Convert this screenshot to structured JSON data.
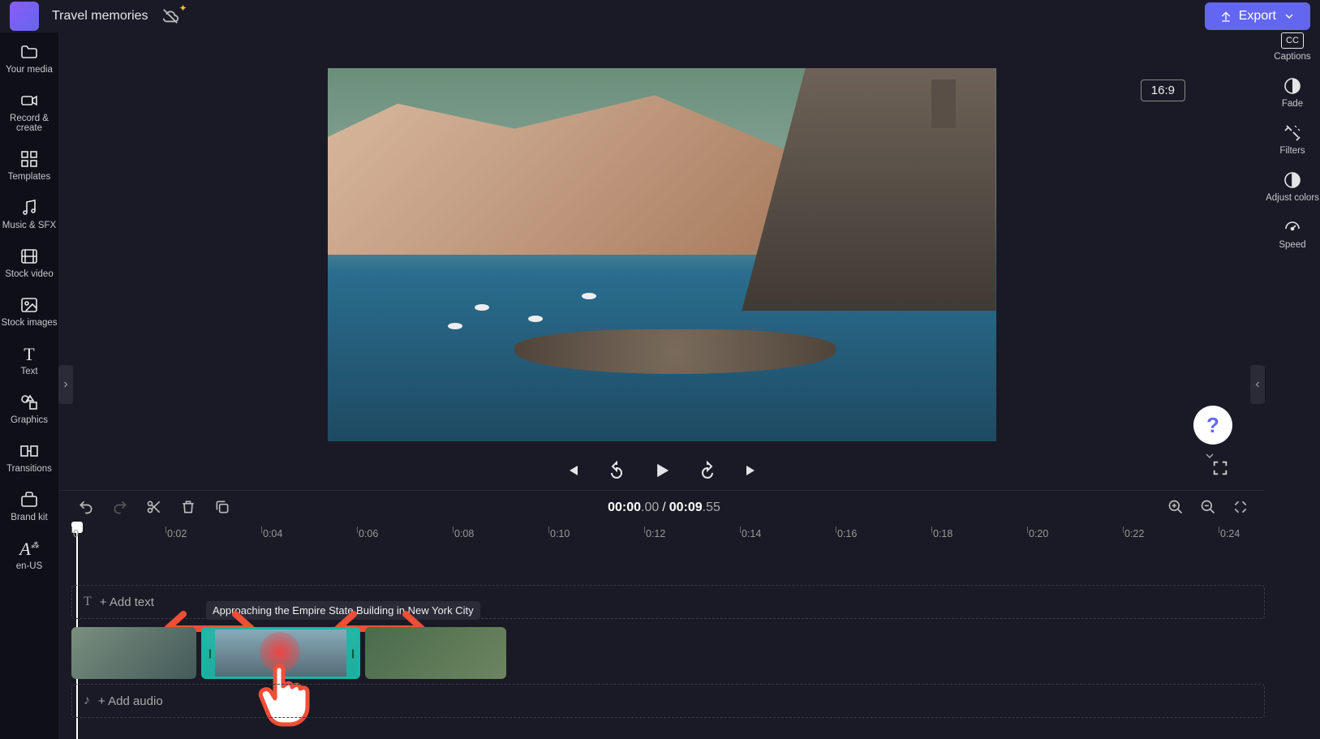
{
  "header": {
    "project_title": "Travel memories",
    "export_label": "Export"
  },
  "left_sidebar": {
    "items": [
      {
        "label": "Your media",
        "icon": "folder-icon"
      },
      {
        "label": "Record & create",
        "icon": "camcorder-icon"
      },
      {
        "label": "Templates",
        "icon": "templates-icon"
      },
      {
        "label": "Music & SFX",
        "icon": "music-icon"
      },
      {
        "label": "Stock video",
        "icon": "film-icon"
      },
      {
        "label": "Stock images",
        "icon": "image-icon"
      },
      {
        "label": "Text",
        "icon": "text-icon"
      },
      {
        "label": "Graphics",
        "icon": "shapes-icon"
      },
      {
        "label": "Transitions",
        "icon": "transitions-icon"
      },
      {
        "label": "Brand kit",
        "icon": "briefcase-icon"
      },
      {
        "label": "en-US",
        "icon": "language-icon"
      }
    ]
  },
  "right_sidebar": {
    "items": [
      {
        "label": "Captions",
        "icon": "captions-icon"
      },
      {
        "label": "Fade",
        "icon": "fade-icon"
      },
      {
        "label": "Filters",
        "icon": "filters-icon"
      },
      {
        "label": "Adjust colors",
        "icon": "adjust-colors-icon"
      },
      {
        "label": "Speed",
        "icon": "speed-icon"
      }
    ]
  },
  "preview": {
    "aspect_ratio": "16:9"
  },
  "playback": {
    "current_main": "00:00",
    "current_frac": ".00",
    "separator": "/",
    "duration_main": "00:09",
    "duration_frac": ".55"
  },
  "ruler": {
    "start_label": "0",
    "ticks": [
      "0:02",
      "0:04",
      "0:06",
      "0:08",
      "0:10",
      "0:12",
      "0:14",
      "0:16",
      "0:18",
      "0:20",
      "0:22",
      "0:24"
    ]
  },
  "tracks": {
    "text_placeholder": "+ Add text",
    "audio_placeholder": "+ Add audio",
    "clip_tooltip": "Approaching the Empire State Building in New York City"
  },
  "colors": {
    "accent": "#6366f1",
    "annotation": "#f04e37",
    "clip_selected": "#14b8a6"
  }
}
